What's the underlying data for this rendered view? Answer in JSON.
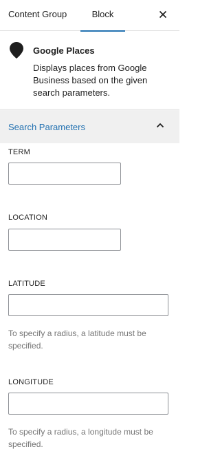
{
  "tabs": {
    "content_group": "Content Group",
    "block": "Block"
  },
  "close_icon": "close-icon",
  "block": {
    "icon": "location-pin-icon",
    "title": "Google Places",
    "description": "Displays places from Google Business based on the given search parameters."
  },
  "panel": {
    "title": "Search Parameters",
    "expanded": true,
    "chevron_icon": "chevron-up-icon"
  },
  "fields": {
    "term": {
      "label": "TERM",
      "value": ""
    },
    "location": {
      "label": "LOCATION",
      "value": ""
    },
    "latitude": {
      "label": "LATITUDE",
      "value": "",
      "help": "To specify a radius, a latitude must be specified."
    },
    "longitude": {
      "label": "LONGITUDE",
      "value": "",
      "help": "To specify a radius, a longitude must be specified."
    }
  },
  "colors": {
    "accent": "#2271b1",
    "panel_bg": "#f0f0f0",
    "help_text": "#757575"
  }
}
